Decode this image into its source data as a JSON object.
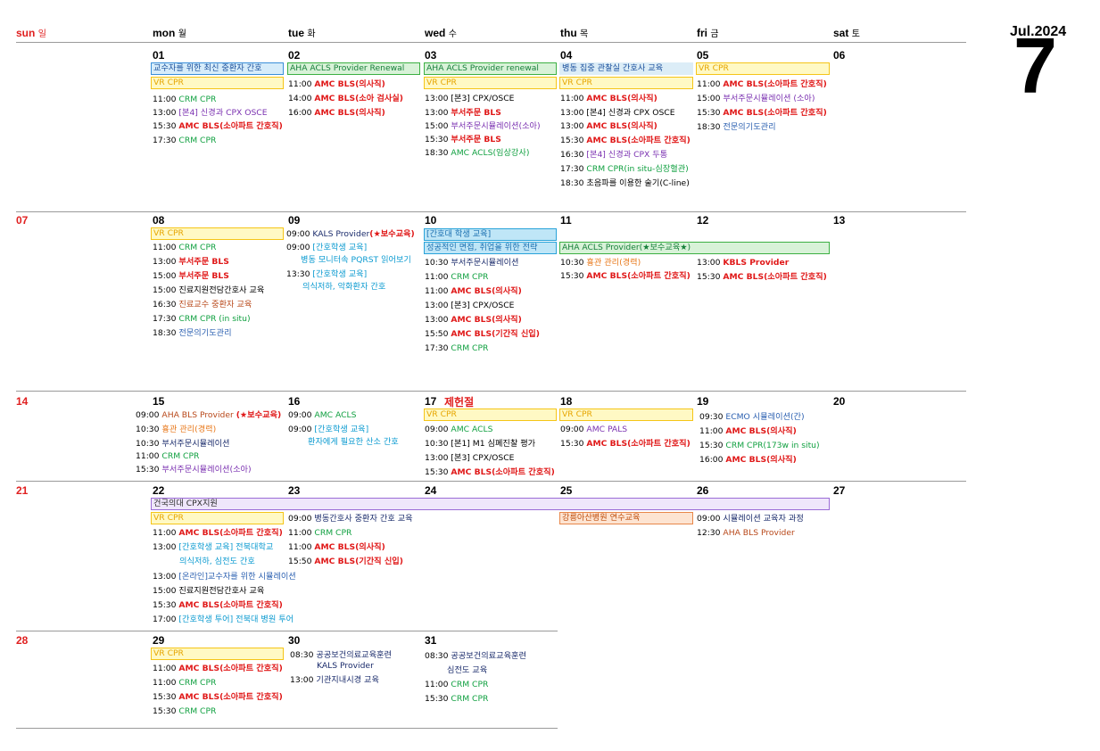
{
  "header": {
    "month_label": "Jul.2024",
    "month_number": "7"
  },
  "weekdays": [
    {
      "en": "sun",
      "ko": "일"
    },
    {
      "en": "mon",
      "ko": "월"
    },
    {
      "en": "tue",
      "ko": "화"
    },
    {
      "en": "wed",
      "ko": "수"
    },
    {
      "en": "thu",
      "ko": "목"
    },
    {
      "en": "fri",
      "ko": "금"
    },
    {
      "en": "sat",
      "ko": "토"
    }
  ],
  "days": {
    "d01": "01",
    "d02": "02",
    "d03": "03",
    "d04": "04",
    "d05": "05",
    "d06": "06",
    "d07": "07",
    "d08": "08",
    "d09": "09",
    "d10": "10",
    "d11": "11",
    "d12": "12",
    "d13": "13",
    "d14": "14",
    "d15": "15",
    "d16": "16",
    "d17": "17",
    "d18": "18",
    "d19": "19",
    "d20": "20",
    "d21": "21",
    "d22": "22",
    "d23": "23",
    "d24": "24",
    "d25": "25",
    "d26": "26",
    "d27": "27",
    "d28": "28",
    "d29": "29",
    "d30": "30",
    "d31": "31"
  },
  "holiday_17": "제헌절",
  "bars": {
    "b01_1": "교수자를 위한 최신 중환자 간호",
    "b01_2": "VR CPR",
    "b02_1": "AHA  ACLS Provider  Renewal",
    "b03_1": "AHA ACLS Provider renewal",
    "b03_2": "VR CPR",
    "b04_1": "병동 집중 관찰실 간호사 교육",
    "b04_2": "VR CPR",
    "b05_1": "VR CPR",
    "b08_1": "VR CPR",
    "b10_1": "[간호대 학생 교육]",
    "b10_2": "성공적인 면접, 취업을 위한 전략",
    "b11_1": "AHA ACLS Provider(★보수교육★)",
    "b17_1": "VR CPR",
    "b18_1": "VR CPR",
    "b22_0": "건국의대 CPX지원",
    "b22_1": "VR CPR",
    "b25_1": "강릉아산병원 연수교육",
    "b29_1": "VR CPR"
  },
  "events": {
    "e01_1_t": "11:00",
    "e01_1_x": "CRM CPR",
    "e01_2_t": "13:00",
    "e01_2_x": "[본4] 신경과 CPX OSCE",
    "e01_3_t": "15:30",
    "e01_3_x": "AMC BLS(소아파트 간호직)",
    "e01_4_t": "17:30",
    "e01_4_x": "CRM CPR",
    "e02_1_t": "11:00",
    "e02_1_x": "AMC BLS(의사직)",
    "e02_2_t": "14:00",
    "e02_2_x": "AMC BLS(소아 검사실)",
    "e02_3_t": "16:00",
    "e02_3_x": "AMC BLS(의사직)",
    "e03_1_t": "13:00",
    "e03_1_x": "[본3] CPX/OSCE",
    "e03_2_t": "13:00",
    "e03_2_x": "부서주문 BLS",
    "e03_3_t": "15:00",
    "e03_3_x": "부서주문시뮬레이션(소아)",
    "e03_4_t": "15:30",
    "e03_4_x": "부서주문 BLS",
    "e03_5_t": "18:30",
    "e03_5_x": "AMC ACLS(임상강사)",
    "e04_1_t": "11:00",
    "e04_1_x": "AMC BLS(의사직)",
    "e04_2_t": "13:00",
    "e04_2_x": "[본4] 신경과 CPX OSCE",
    "e04_3_t": "13:00",
    "e04_3_x": "AMC BLS(의사직)",
    "e04_4_t": "15:30",
    "e04_4_x": "AMC BLS(소아파트 간호직)",
    "e04_5_t": "16:30",
    "e04_5_x": "[본4] 신경과 CPX 두통",
    "e04_6_t": "17:30",
    "e04_6_x": "CRM CPR(in situ-심장혈관)",
    "e04_7_t": "18:30",
    "e04_7_x": "초음파를 이용한 술기(C-line)",
    "e05_1_t": "11:00",
    "e05_1_x": "AMC BLS(소아파트 간호직)",
    "e05_2_t": "15:00",
    "e05_2_x": "부서주문시뮬레이션 (소아)",
    "e05_3_t": "15:30",
    "e05_3_x": "AMC BLS(소아파트 간호직)",
    "e05_4_t": "18:30",
    "e05_4_x": "전문의기도관리",
    "e08_1_t": "11:00",
    "e08_1_x": "CRM CPR",
    "e08_2_t": "13:00",
    "e08_2_x": "부서주문 BLS",
    "e08_3_t": "15:00",
    "e08_3_x": "부서주문 BLS",
    "e08_4_t": "15:00",
    "e08_4_x": "진료지원전담간호사 교육",
    "e08_5_t": "16:30",
    "e08_5_x": "진료교수 중환자 교육",
    "e08_6_t": "17:30",
    "e08_6_x": "CRM CPR (in situ)",
    "e08_7_t": "18:30",
    "e08_7_x": "전문의기도관리",
    "e09_1_t": "09:00",
    "e09_1_x": "KALS Provider",
    "e09_1_y": "(★보수교육)",
    "e09_2_t": "09:00",
    "e09_2_x": "[간호학생 교육]",
    "e09_2_l2": "병동 모니터속 PQRST 읽어보기",
    "e09_3_t": "13:30",
    "e09_3_x": "[간호학생 교육]",
    "e09_3_l2": "의식저하, 악화환자 간호",
    "e10_1_t": "10:30",
    "e10_1_x": "부서주문시뮬레이션",
    "e10_2_t": "11:00",
    "e10_2_x": "CRM CPR",
    "e10_3_t": "11:00",
    "e10_3_x": "AMC BLS(의사직)",
    "e10_4_t": "13:00",
    "e10_4_x": "[본3] CPX/OSCE",
    "e10_5_t": "13:00",
    "e10_5_x": "AMC BLS(의사직)",
    "e10_6_t": "15:50",
    "e10_6_x": "AMC BLS(기간직 신입)",
    "e10_7_t": "17:30",
    "e10_7_x": "CRM CPR",
    "e11_1_t": "10:30",
    "e11_1_x": "흉관 관리(경력)",
    "e11_2_t": "15:30",
    "e11_2_x": "AMC BLS(소아파트 간호직)",
    "e12_1_t": "13:00",
    "e12_1_x": "KBLS Provider",
    "e12_2_t": "15:30",
    "e12_2_x": "AMC BLS(소아파트 간호직)",
    "e15_1_t": "09:00",
    "e15_1_x": "AHA BLS Provider",
    "e15_1_y": "(★보수교육)",
    "e15_2_t": "10:30",
    "e15_2_x": "흉관 관리(경력)",
    "e15_3_t": "10:30",
    "e15_3_x": "부서주문시뮬레이션",
    "e15_4_t": "11:00",
    "e15_4_x": "CRM CPR",
    "e15_5_t": "15:30",
    "e15_5_x": "부서주문시뮬레이션(소아)",
    "e16_1_t": "09:00",
    "e16_1_x": "AMC ACLS",
    "e16_2_t": "09:00",
    "e16_2_x": "[간호학생 교육]",
    "e16_2_l2": "환자에게 필요한 산소 간호",
    "e17_1_t": "09:00",
    "e17_1_x": "AMC ACLS",
    "e17_2_t": "10:30",
    "e17_2_x": "[본1] M1 심폐진찰 평가",
    "e17_3_t": "13:00",
    "e17_3_x": "[본3] CPX/OSCE",
    "e17_4_t": "15:30",
    "e17_4_x": "AMC BLS(소아파트 간호직)",
    "e18_1_t": "09:00",
    "e18_1_x": "AMC PALS",
    "e18_2_t": "15:30",
    "e18_2_x": "AMC BLS(소아파트 간호직)",
    "e19_1_t": "09:30",
    "e19_1_x": "ECMO 시뮬레이션(간)",
    "e19_2_t": "11:00",
    "e19_2_x": "AMC BLS(의사직)",
    "e19_3_t": "15:30",
    "e19_3_x": "CRM CPR(173w in situ)",
    "e19_4_t": "16:00",
    "e19_4_x": "AMC BLS(의사직)",
    "e22_1_t": "11:00",
    "e22_1_x": "AMC BLS(소아파트 간호직)",
    "e22_2_t": "13:00",
    "e22_2_x": "[간호학생 교육] 전북대학교",
    "e22_2_l2": "의식저하, 심전도 간호",
    "e22_3_t": "13:00",
    "e22_3_x": "[온라인]교수자를 위한 시뮬레이션",
    "e22_4_t": "15:00",
    "e22_4_x": "진료지원전담간호사 교육",
    "e22_5_t": "15:30",
    "e22_5_x": "AMC BLS(소아파트 간호직)",
    "e22_6_t": "17:00",
    "e22_6_x": "[간호학생 투어] 전북대 병원 투어",
    "e23_1_t": "09:00",
    "e23_1_x": "병동간호사 중환자 간호 교육",
    "e23_2_t": "11:00",
    "e23_2_x": "CRM CPR",
    "e23_3_t": "11:00",
    "e23_3_x": "AMC BLS(의사직)",
    "e23_4_t": "15:50",
    "e23_4_x": "AMC BLS(기간직 신입)",
    "e26_1_t": "09:00",
    "e26_1_x": "시뮬레이션 교육자 과정",
    "e26_2_t": "12:30",
    "e26_2_x": "AHA BLS Provider",
    "e29_1_t": "11:00",
    "e29_1_x": "AMC BLS(소아파트 간호직)",
    "e29_2_t": "11:00",
    "e29_2_x": "CRM CPR",
    "e29_3_t": "15:30",
    "e29_3_x": "AMC BLS(소아파트 간호직)",
    "e29_4_t": "15:30",
    "e29_4_x": "CRM CPR",
    "e30_1_t": "08:30",
    "e30_1_x": "공공보건의료교육훈련",
    "e30_1_l2": "KALS Provider",
    "e30_2_t": "13:00",
    "e30_2_x": "기관지내시경 교육",
    "e31_1_t": "08:30",
    "e31_1_x": "공공보건의료교육훈련",
    "e31_1_l2": "심전도 교육",
    "e31_2_t": "11:00",
    "e31_2_x": "CRM CPR",
    "e31_3_t": "15:30",
    "e31_3_x": "CRM CPR"
  },
  "colors": {
    "sunday": "#e02020",
    "amc_bls": "#e01818",
    "crm_cpr": "#10a040",
    "vr_cpr_fill": "#fff9c4",
    "vr_cpr_text": "#e6a500"
  }
}
